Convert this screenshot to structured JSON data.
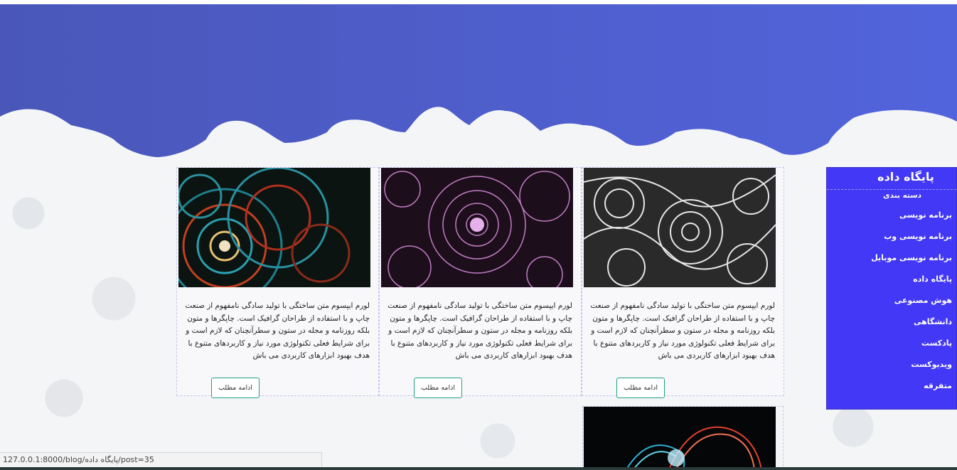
{
  "colors": {
    "header": "#4f5fcf",
    "sidebar": "#4338f5",
    "button_border": "#1fa083"
  },
  "posts": [
    {
      "image": "fractal-spiral-image",
      "text": "لورم ایپسوم متن ساختگی با تولید سادگی نامفهوم از صنعت چاپ و با استفاده از طراحان گرافیک است. چاپگرها و متون بلکه روزنامه و مجله در ستون و سطرآنچنان که لازم است و برای شرایط فعلی تکنولوژی مورد نیاز و کاربردهای متنوع با هدف بهبود ابزارهای کاربردی می باش",
      "button": "ادامه مطلب"
    },
    {
      "image": "pink-fractal-image",
      "text": "لورم ایپسوم متن ساختگی با تولید سادگی نامفهوم از صنعت چاپ و با استفاده از طراحان گرافیک است. چاپگرها و متون بلکه روزنامه و مجله در ستون و سطرآنچنان که لازم است و برای شرایط فعلی تکنولوژی مورد نیاز و کاربردهای متنوع با هدف بهبود ابزارهای کاربردی می باش",
      "button": "ادامه مطلب"
    },
    {
      "image": "paisley-pattern-image",
      "text": "لورم ایپسوم متن ساختگی با تولید سادگی نامفهوم از صنعت چاپ و با استفاده از طراحان گرافیک است. چاپگرها و متون بلکه روزنامه و مجله در ستون و سطرآنچنان که لازم است و برای شرایط فعلی تکنولوژی مورد نیاز و کاربردهای متنوع با هدف بهبود ابزارهای کاربردی می باش",
      "button": "ادامه مطلب"
    }
  ],
  "sidebar": {
    "title": "پایگاه داده",
    "category_heading": "دسته بندی",
    "items": [
      "برنامه نویسی",
      "برنامه نویسی وب",
      "برنامه نویسی موبایل",
      "پایگاه داده",
      "هوش مصنوعی",
      "دانشگاهی",
      "پادکست",
      "ویدیوکست",
      "متفرقه"
    ]
  },
  "status_url": "127.0.0.1:8000/blog/پایگاه داده/post=35"
}
